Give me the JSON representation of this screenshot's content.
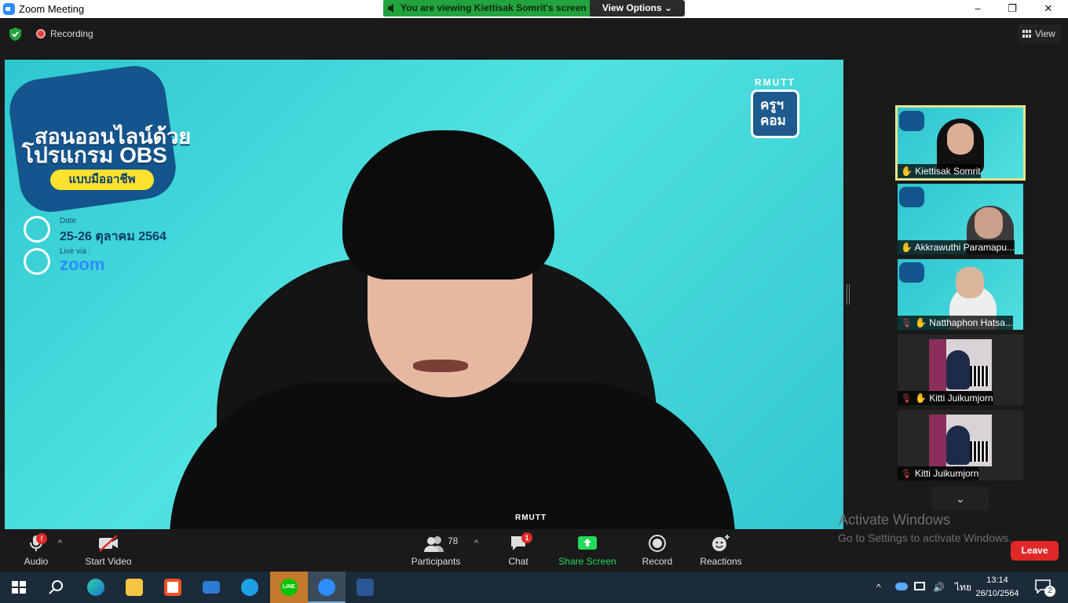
{
  "window": {
    "title": "Zoom Meeting",
    "minimize": "–",
    "maximize": "❐",
    "close": "✕"
  },
  "banner": {
    "viewing_text": "You are viewing Kiettisak Somrit's screen",
    "view_options_label": "View Options",
    "view_options_caret": "⌄"
  },
  "top_bar": {
    "recording_label": "Recording",
    "view_label": "View"
  },
  "shared_screen": {
    "title_line1": "สอนออนไลน์ด้วย",
    "title_line2": "โปรแกรม OBS",
    "pill": "แบบมืออาชีพ",
    "date_label": "Date",
    "date_value": "25-26 ตุลาคม 2564",
    "live_label": "Live via :",
    "live_value": "zoom",
    "logo_top": "RMUTT",
    "logo_line1": "ครูฯ",
    "logo_line2": "คอม",
    "shirt_text": "RMUTT"
  },
  "participants_strip": [
    {
      "name": "Kiettisak Somrit",
      "active": true
    },
    {
      "name": "Akkrawuthi Paramapu...",
      "active": false
    },
    {
      "name": "Natthaphon Hatsa...",
      "active": false
    },
    {
      "name": "Kitti Juikumjorn",
      "active": false
    },
    {
      "name": "Kitti Juikumjorn",
      "active": false
    }
  ],
  "strip_scroll_icon": "⌄",
  "activation": {
    "line1": "Activate Windows",
    "line2": "Go to Settings to activate Windows."
  },
  "controls": {
    "audio": "Audio",
    "start_video": "Start Video",
    "participants": "Participants",
    "participants_count": "78",
    "chat": "Chat",
    "chat_badge": "1",
    "audio_badge": "!",
    "share_screen": "Share Screen",
    "record": "Record",
    "reactions": "Reactions",
    "leave": "Leave",
    "caret": "^"
  },
  "taskbar": {
    "time": "13:14",
    "date": "26/10/2564",
    "lang": "ไทย",
    "notification_count": "2",
    "line_label": "LINE"
  },
  "colors": {
    "zoom_blue": "#2d8cff",
    "banner_green": "#23a33e",
    "leave_red": "#e02828",
    "share_green": "#23d959"
  }
}
